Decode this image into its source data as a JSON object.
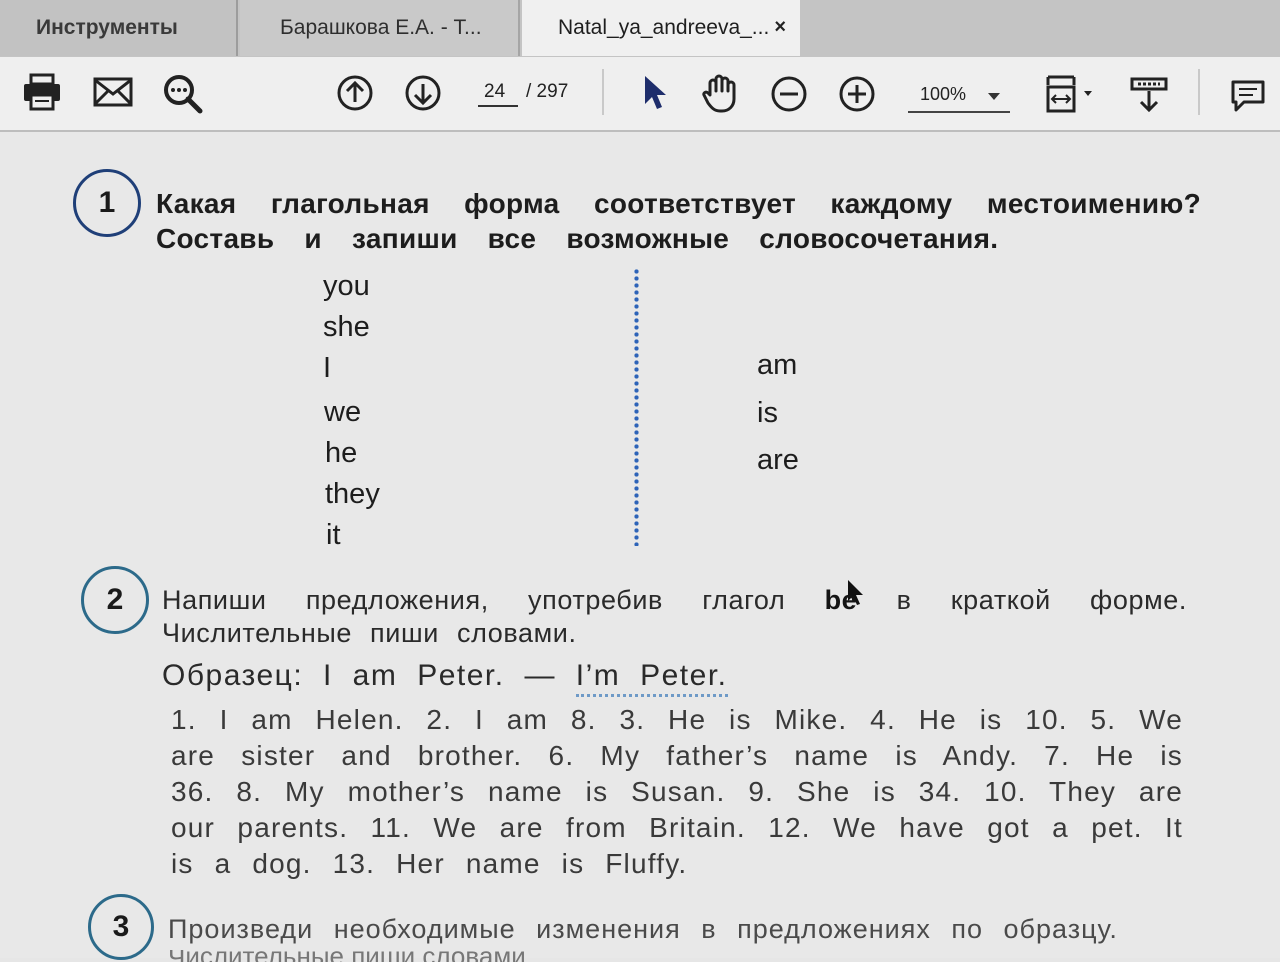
{
  "tabs": [
    {
      "label": "Инструменты"
    },
    {
      "label": "Барашкова Е.А. - Т..."
    },
    {
      "label": "Natal_ya_andreeva_...",
      "close_icon": "×"
    }
  ],
  "toolbar": {
    "icons": [
      "printer-icon",
      "mail-icon",
      "search-zoom-icon",
      "page-up-icon",
      "page-down-icon",
      "select-arrow-icon",
      "hand-icon",
      "zoom-out-icon",
      "zoom-in-icon",
      "fit-page-icon",
      "scroll-mode-icon",
      "comment-icon"
    ],
    "page_current": "24",
    "page_total": "/ 297",
    "zoom": "100%"
  },
  "exercise1": {
    "number": "1",
    "instruction": "Какая глагольная форма соответствует каждому местоимению? Составь и запиши все возможные словосочетания.",
    "pronouns": [
      "you",
      "she",
      "I",
      "we",
      "he",
      "they",
      "it"
    ],
    "verbs": [
      "am",
      "is",
      "are"
    ]
  },
  "exercise2": {
    "number": "2",
    "instruction_a": "Напиши предложения, употребив глагол",
    "instruction_bold": "be",
    "instruction_b": "в краткой форме. Числительные пиши словами.",
    "sample_label": "Образец:",
    "sample_full": "I am Peter.",
    "sample_dash": "—",
    "sample_short": "I’m Peter.",
    "sentences": "1. I am Helen. 2. I am 8. 3. He is Mike. 4. He is 10. 5. We are sister and brother. 6. My father’s name is Andy. 7. He is 36. 8. My mother’s name is Susan. 9. She is 34. 10. They are our parents. 11. We are from Britain. 12. We have got a pet. It is a dog. 13. Her name is Fluffy."
  },
  "exercise3": {
    "number": "3",
    "instruction": "Произведи необходимые изменения в предложениях по образцу.",
    "cut_line": "Числительные пиши словами."
  }
}
